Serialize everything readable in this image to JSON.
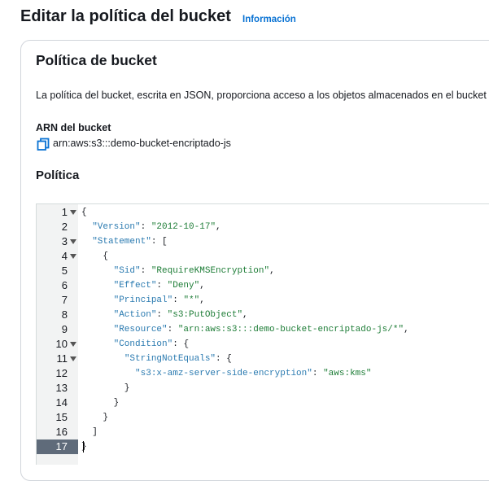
{
  "header": {
    "title": "Editar la política del bucket",
    "info_link": "Información"
  },
  "section": {
    "title": "Política de bucket",
    "description": "La política del bucket, escrita en JSON, proporciona acceso a los objetos almacenados en el bucket",
    "arn_label": "ARN del bucket",
    "arn_value": "arn:aws:s3:::demo-bucket-encriptado-js",
    "policy_title": "Política"
  },
  "editor": {
    "active_line": 17,
    "lines": [
      {
        "n": "1",
        "fold": true,
        "code": "{"
      },
      {
        "n": "2",
        "fold": false,
        "indent": "  ",
        "key": "\"Version\"",
        "sep": ": ",
        "val": "\"2012-10-17\"",
        "tail": ","
      },
      {
        "n": "3",
        "fold": true,
        "indent": "  ",
        "key": "\"Statement\"",
        "sep": ": ",
        "tail": "["
      },
      {
        "n": "4",
        "fold": true,
        "code": "    {"
      },
      {
        "n": "5",
        "fold": false,
        "indent": "      ",
        "key": "\"Sid\"",
        "sep": ": ",
        "val": "\"RequireKMSEncryption\"",
        "tail": ","
      },
      {
        "n": "6",
        "fold": false,
        "indent": "      ",
        "key": "\"Effect\"",
        "sep": ": ",
        "val": "\"Deny\"",
        "tail": ","
      },
      {
        "n": "7",
        "fold": false,
        "indent": "      ",
        "key": "\"Principal\"",
        "sep": ": ",
        "val": "\"*\"",
        "tail": ","
      },
      {
        "n": "8",
        "fold": false,
        "indent": "      ",
        "key": "\"Action\"",
        "sep": ": ",
        "val": "\"s3:PutObject\"",
        "tail": ","
      },
      {
        "n": "9",
        "fold": false,
        "indent": "      ",
        "key": "\"Resource\"",
        "sep": ": ",
        "val": "\"arn:aws:s3:::demo-bucket-encriptado-js/*\"",
        "tail": ","
      },
      {
        "n": "10",
        "fold": true,
        "indent": "      ",
        "key": "\"Condition\"",
        "sep": ": ",
        "tail": "{"
      },
      {
        "n": "11",
        "fold": true,
        "indent": "        ",
        "key": "\"StringNotEquals\"",
        "sep": ": ",
        "tail": "{"
      },
      {
        "n": "12",
        "fold": false,
        "indent": "          ",
        "key": "\"s3:x-amz-server-side-encryption\"",
        "sep": ": ",
        "val": "\"aws:kms\""
      },
      {
        "n": "13",
        "fold": false,
        "code": "        }"
      },
      {
        "n": "14",
        "fold": false,
        "code": "      }"
      },
      {
        "n": "15",
        "fold": false,
        "code": "    }"
      },
      {
        "n": "16",
        "fold": false,
        "code": "  ]"
      },
      {
        "n": "17",
        "fold": false,
        "code": "}"
      }
    ]
  }
}
